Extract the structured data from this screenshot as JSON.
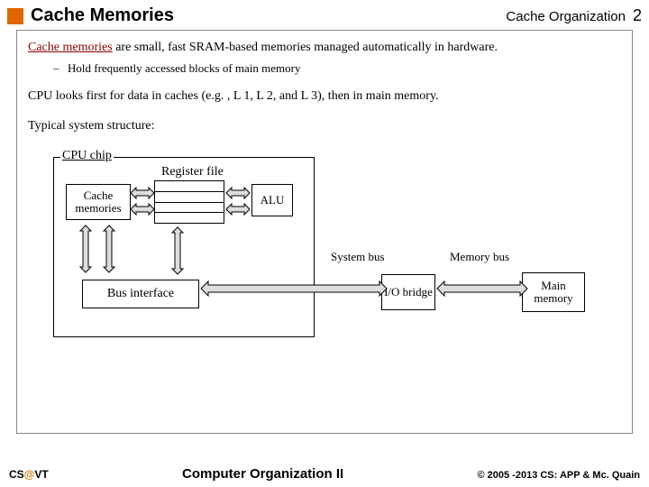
{
  "header": {
    "title": "Cache Memories",
    "subtitle": "Cache Organization",
    "page": "2"
  },
  "body": {
    "intro_underlined": "Cache memories",
    "intro_rest": " are small, fast SRAM-based memories managed automatically in hardware.",
    "bullet1": "Hold frequently accessed blocks of main memory",
    "para2": "CPU looks first for data in caches (e.g. , L 1, L 2, and L 3), then in main memory.",
    "para3": "Typical system structure:"
  },
  "diagram": {
    "cpu_chip": "CPU chip",
    "register_file": "Register file",
    "cache": "Cache memories",
    "alu": "ALU",
    "bus_interface": "Bus interface",
    "system_bus": "System bus",
    "memory_bus": "Memory bus",
    "io_bridge": "I/O bridge",
    "main_memory": "Main memory"
  },
  "footer": {
    "left_cs": "CS",
    "left_at": "@",
    "left_vt": "VT",
    "center": "Computer Organization II",
    "right": "© 2005 -2013 CS: APP & Mc. Quain"
  }
}
